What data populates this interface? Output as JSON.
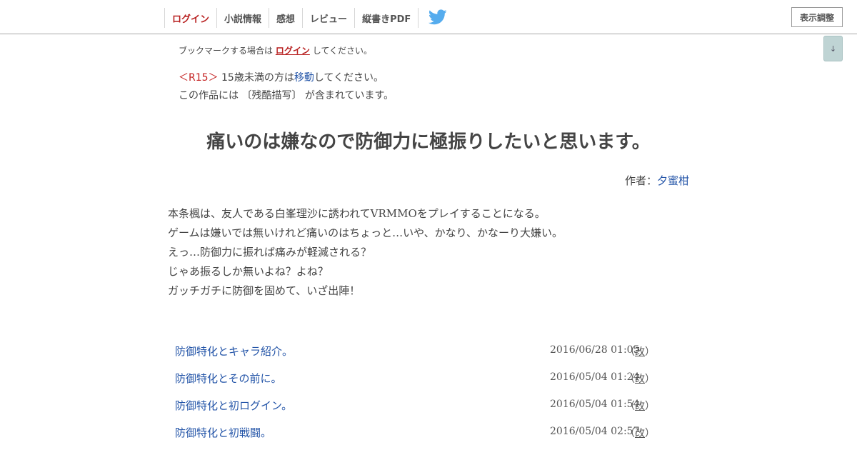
{
  "nav": {
    "items": [
      "ログイン",
      "小説情報",
      "感想",
      "レビュー",
      "縦書きPDF"
    ],
    "twitter_icon": "twitter-bird-icon",
    "settings_label": "表示調整",
    "scroll_down_label": "↓"
  },
  "bookmark_note": {
    "prefix": "ブックマークする場合は",
    "login_label": "ログイン",
    "suffix": "してください。"
  },
  "rating": {
    "tag": "＜R15＞",
    "text_before": "15歳未満の方は",
    "move_label": "移動",
    "text_after": "してください。",
    "warning": "この作品には 〔残酷描写〕 が含まれています。"
  },
  "title": "痛いのは嫌なので防御力に極振りしたいと思います。",
  "author": {
    "label": "作者：",
    "name": "夕蜜柑"
  },
  "summary": [
    "本条楓は、友人である白峯理沙に誘われてVRMMOをプレイすることになる。",
    "ゲームは嫌いでは無いけれど痛いのはちょっと…いや、かなり、かなーり大嫌い。",
    "えっ…防御力に振れば痛みが軽減される？",
    "じゃあ振るしか無いよね？よね？",
    "ガッチガチに防御を固めて、いざ出陣！"
  ],
  "chapters": [
    {
      "title": "防御特化とキャラ紹介。",
      "date": "2016/06/28 01:05",
      "rev_open": "（",
      "rev_label": "改",
      "rev_close": "）"
    },
    {
      "title": "防御特化とその前に。",
      "date": "2016/05/04 01:24",
      "rev_open": "（",
      "rev_label": "改",
      "rev_close": "）"
    },
    {
      "title": "防御特化と初ログイン。",
      "date": "2016/05/04 01:54",
      "rev_open": "（",
      "rev_label": "改",
      "rev_close": "）"
    },
    {
      "title": "防御特化と初戦闘。",
      "date": "2016/05/04 02:57",
      "rev_open": "（",
      "rev_label": "改",
      "rev_close": "）"
    }
  ],
  "colors": {
    "link": "#2455a8",
    "login_red": "#b82020",
    "r15_red": "#c42222",
    "text": "#444444"
  }
}
